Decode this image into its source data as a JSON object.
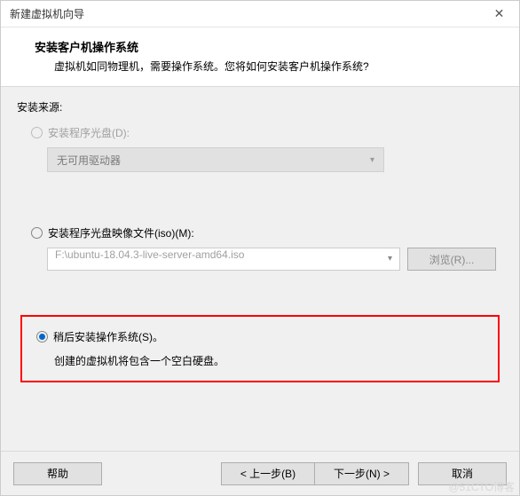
{
  "titlebar": {
    "title": "新建虚拟机向导"
  },
  "header": {
    "title": "安装客户机操作系统",
    "desc": "虚拟机如同物理机，需要操作系统。您将如何安装客户机操作系统?"
  },
  "content": {
    "source_label": "安装来源:"
  },
  "option_disc": {
    "label": "安装程序光盘(D):",
    "combo": "无可用驱动器"
  },
  "option_iso": {
    "label": "安装程序光盘映像文件(iso)(M):",
    "path": "F:\\ubuntu-18.04.3-live-server-amd64.iso",
    "browse": "浏览(R)..."
  },
  "option_later": {
    "label": "稍后安装操作系统(S)。",
    "desc": "创建的虚拟机将包含一个空白硬盘。"
  },
  "footer": {
    "help": "帮助",
    "back": "< 上一步(B)",
    "next": "下一步(N) >",
    "cancel": "取消"
  },
  "watermark": "@51CTO博客"
}
